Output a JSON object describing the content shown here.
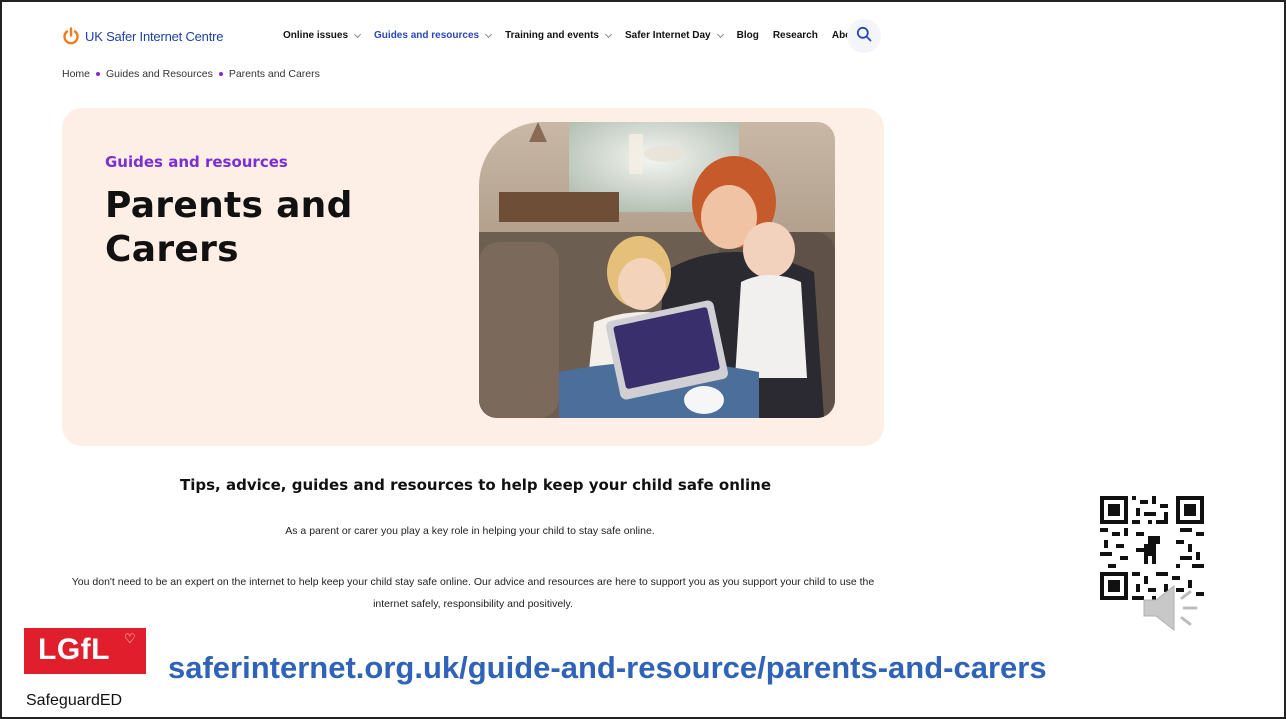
{
  "brand": {
    "name": "UK Safer Internet Centre"
  },
  "nav": {
    "items": [
      {
        "label": "Online issues",
        "has_dropdown": true,
        "active": false
      },
      {
        "label": "Guides and resources",
        "has_dropdown": true,
        "active": true
      },
      {
        "label": "Training and events",
        "has_dropdown": true,
        "active": false
      },
      {
        "label": "Safer Internet Day",
        "has_dropdown": true,
        "active": false
      },
      {
        "label": "Blog",
        "has_dropdown": false,
        "active": false
      },
      {
        "label": "Research",
        "has_dropdown": false,
        "active": false
      },
      {
        "label": "About",
        "has_dropdown": false,
        "active": false
      }
    ],
    "search_icon": "search-icon"
  },
  "breadcrumb": [
    "Home",
    "Guides and Resources",
    "Parents and Carers"
  ],
  "hero": {
    "kicker": "Guides and resources",
    "title": "Parents and Carers"
  },
  "intro": {
    "heading": "Tips, advice, guides and resources to help keep your child safe online",
    "paragraph1": "As a parent or carer you play a key role in helping your child to stay safe online.",
    "paragraph2": "You don't need to be an expert on the internet to help keep your child stay safe online. Our advice and resources are here to support you as you support your child to use the internet safely, responsibility and positively."
  },
  "footer": {
    "logo_text": "LGfL",
    "logo_sub": "SafeguardED",
    "url": "saferinternet.org.uk/guide-and-resource/parents-and-carers"
  },
  "colors": {
    "brand_blue": "#1f3fa5",
    "accent_purple": "#7a2fd0",
    "hero_bg": "#fdeee6",
    "logo_orange": "#f07c1a",
    "lgfl_red": "#e11f2c",
    "url_blue": "#2e63b8"
  }
}
